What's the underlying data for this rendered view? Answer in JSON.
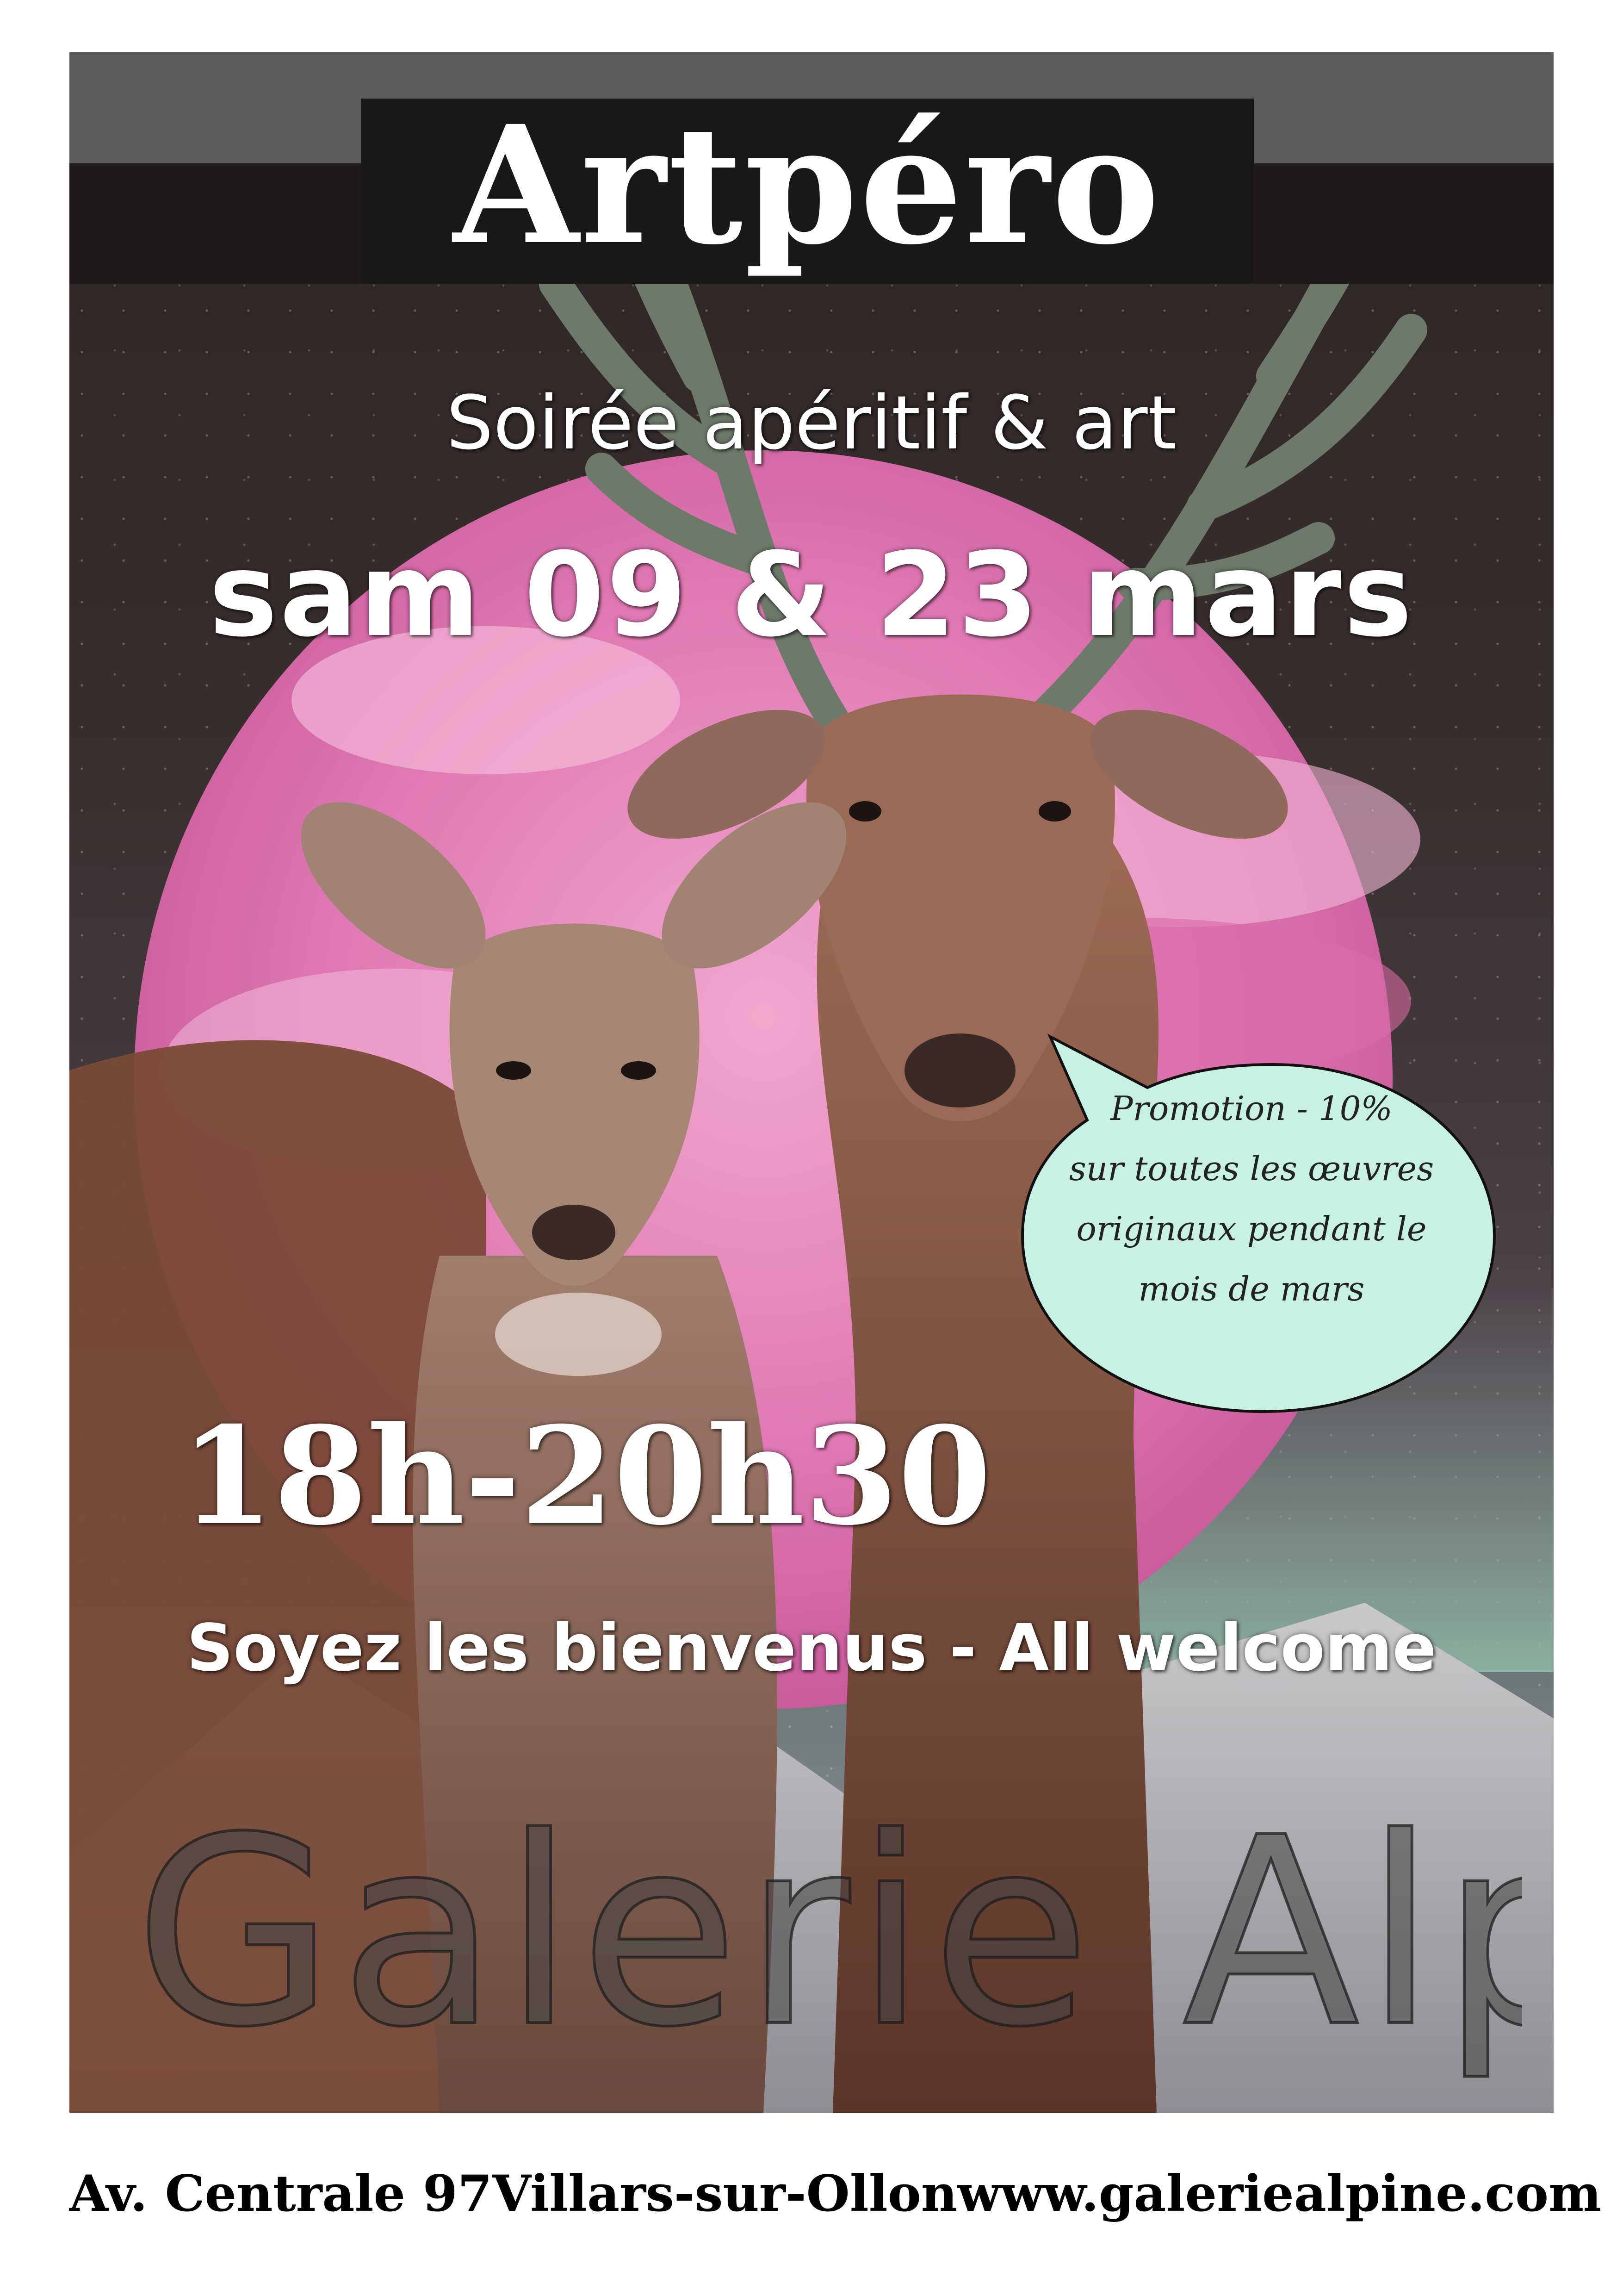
{
  "title": "Artpéro",
  "subtitle": "Soirée apéritif & art",
  "dates": "sam 09 & 23 mars",
  "hours": "18h-20h30",
  "welcome": "Soyez les bienvenus - All welcome",
  "gallery_logo": "Galerie Alpine",
  "promo": {
    "lines": [
      "Promotion - 10%",
      "sur toutes les œuvres",
      "originaux pendant le",
      "mois de mars"
    ]
  },
  "footer": {
    "address": "Av. Centrale 97",
    "town": "Villars-sur-Ollon",
    "website": "www.galeriealpine.com"
  },
  "colors": {
    "moon": "#e07ab4",
    "bubble_fill": "#c8f1e6",
    "title_band": "#1e1a19",
    "title_band_top": "#5c5c5c"
  },
  "icons": {
    "art": "deer-pair-painting",
    "bubble": "speech-bubble-icon"
  }
}
